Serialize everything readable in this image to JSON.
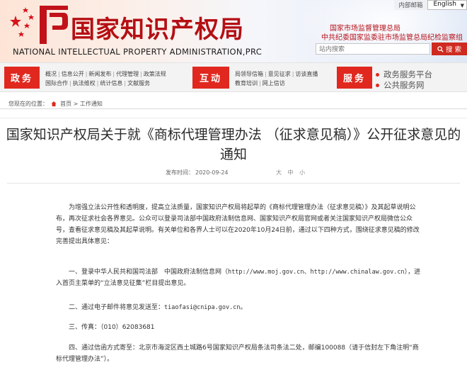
{
  "header": {
    "title_cn": "国家知识产权局",
    "title_en": "NATIONAL INTELLECTUAL PROPERTY ADMINISTRATION,PRC",
    "top_links": [
      "内部邮箱"
    ],
    "language": "English",
    "org_line1": "国家市场监督管理总局",
    "org_line2": "中共纪委国家监委驻市场监管总局纪检监察组",
    "search": {
      "placeholder": "站内搜索",
      "button": "搜 索"
    },
    "brand_color": "#c0141b"
  },
  "nav": {
    "blocks": [
      "政务",
      "互动",
      "服务"
    ],
    "gov_links": {
      "row1": [
        "概况",
        "信息公开",
        "新闻发布",
        "代理管理",
        "政策法规"
      ],
      "row2": [
        "国际合作",
        "执法维权",
        "统计信息",
        "文献服务"
      ]
    },
    "interact_links": {
      "row1": [
        "局领导信箱",
        "意见征求",
        "访谈直播"
      ],
      "row2": [
        "教育培训",
        "网上信访"
      ]
    },
    "platforms": [
      "政务服务平台",
      "公共服务网"
    ],
    "accent_color": "#e0281f"
  },
  "breadcrumb": {
    "prefix": "您现在的位置：",
    "items": [
      "首页",
      "工作通知"
    ],
    "separator": ">"
  },
  "article": {
    "title": "国家知识产权局关于就《商标代理管理办法 （征求意见稿）》公开征求意见的通知",
    "date_label": "发布时间：",
    "date": "2020-09-24",
    "font_size_opts": "大 中 小",
    "p1": "为增强立法公开性和透明度，提高立法质量，国家知识产权局将起草的《商标代理管理办法（征求意见稿）》及其起草说明公布，再次征求社会各界意见。公众可以登录司法部中国政府法制信息网、国家知识产权局官网或者关注国家知识产权局微信公众号，查看征求意见稿及其起草说明。有关单位和各界人士可以在2020年10月24日前，通过以下四种方式，围绕征求意见稿的修改完善提出具体意见：",
    "p2_a": "一、登录中华人民共和国司法部　中国政府法制信息网（",
    "p2_url1": "http://www.moj.gov.cn",
    "p2_b": "、",
    "p2_url2": "http://www.chinalaw.gov.cn",
    "p2_c": "），进入首页主菜单的“立法意见征集”栏目提出意见。",
    "p3_a": "二、通过电子邮件将意见发送至：",
    "p3_email": "tiaofasi@cnipa.gov.cn",
    "p3_b": "。",
    "p4_a": "三、传真：（010）",
    "p4_fax": "62083681",
    "p5": "四、通过信函方式寄至：北京市海淀区西土城路6号国家知识产权局条法司条法二处，邮编100088（请于信封左下角注明“商标代理管理办法”）。"
  }
}
